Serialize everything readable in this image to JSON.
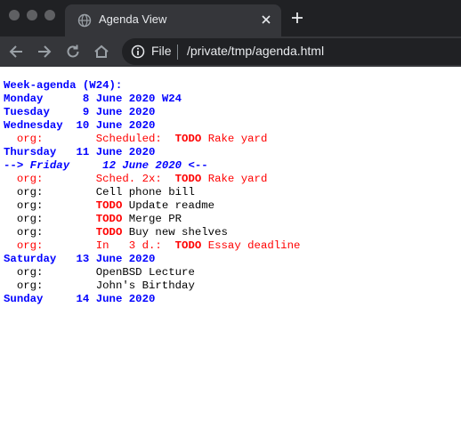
{
  "browser": {
    "tab_title": "Agenda View",
    "scheme_label": "File",
    "url": "/private/tmp/agenda.html"
  },
  "agenda": {
    "header": "Week-agenda (W24):",
    "days": {
      "monday": {
        "name": "Monday",
        "date": "8 June 2020",
        "week": "W24"
      },
      "tuesday": {
        "name": "Tuesday",
        "date": "9 June 2020"
      },
      "wednesday": {
        "name": "Wednesday",
        "date": "10 June 2020"
      },
      "thursday": {
        "name": "Thursday",
        "date": "11 June 2020"
      },
      "friday": {
        "prefix": "-->",
        "name": "Friday",
        "date": "12 June 2020",
        "suffix": "<--"
      },
      "saturday": {
        "name": "Saturday",
        "date": "13 June 2020"
      },
      "sunday": {
        "name": "Sunday",
        "date": "14 June 2020"
      }
    },
    "items": {
      "wed_1": {
        "category": "org:",
        "extra": "Scheduled:",
        "keyword": "TODO",
        "text": "Rake yard"
      },
      "fri_1": {
        "category": "org:",
        "extra": "Sched. 2x:",
        "keyword": "TODO",
        "text": "Rake yard"
      },
      "fri_2": {
        "category": "org:",
        "text": "Cell phone bill"
      },
      "fri_3": {
        "category": "org:",
        "keyword": "TODO",
        "text": "Update readme"
      },
      "fri_4": {
        "category": "org:",
        "keyword": "TODO",
        "text": "Merge PR"
      },
      "fri_5": {
        "category": "org:",
        "keyword": "TODO",
        "text": "Buy new shelves"
      },
      "fri_6": {
        "category": "org:",
        "extra": "In   3 d.:",
        "keyword": "TODO",
        "text": "Essay deadline"
      },
      "sat_1": {
        "category": "org:",
        "text": "OpenBSD Lecture"
      },
      "sat_2": {
        "category": "org:",
        "text": "John's Birthday"
      }
    }
  }
}
